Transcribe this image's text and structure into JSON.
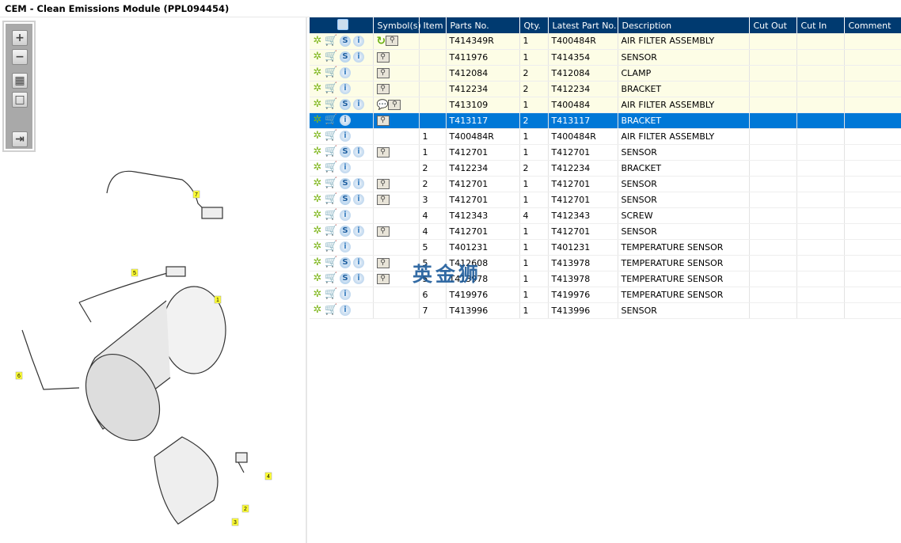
{
  "window": {
    "title": "CEM - Clean Emissions Module (PPL094454)"
  },
  "toolbar": {
    "buttons": [
      {
        "name": "zoom-in",
        "glyph": "+"
      },
      {
        "name": "zoom-out",
        "glyph": "−"
      },
      {
        "name": "fit-all",
        "glyph": "▦"
      },
      {
        "name": "fit-window",
        "glyph": "□"
      },
      {
        "name": "toggle-list",
        "glyph": "⇥"
      }
    ]
  },
  "diagram": {
    "callouts": [
      "1",
      "2",
      "3",
      "4",
      "5",
      "6",
      "7"
    ]
  },
  "table": {
    "headers": [
      "",
      "Symbol(s)",
      "Item",
      "Parts No.",
      "Qty.",
      "Latest Part No.",
      "Description",
      "Cut Out",
      "Cut In",
      "Comment"
    ],
    "rows": [
      {
        "s": true,
        "sym": [
          "rotate",
          "book"
        ],
        "item": "",
        "part": "T414349R",
        "qty": "1",
        "latest": "T400484R",
        "desc": "AIR FILTER ASSEMBLY",
        "hl": "y"
      },
      {
        "s": true,
        "sym": [
          "book"
        ],
        "item": "",
        "part": "T411976",
        "qty": "1",
        "latest": "T414354",
        "desc": "SENSOR",
        "hl": "y"
      },
      {
        "s": false,
        "sym": [
          "book"
        ],
        "item": "",
        "part": "T412084",
        "qty": "2",
        "latest": "T412084",
        "desc": "CLAMP",
        "hl": "y"
      },
      {
        "s": false,
        "sym": [
          "book"
        ],
        "item": "",
        "part": "T412234",
        "qty": "2",
        "latest": "T412234",
        "desc": "BRACKET",
        "hl": "y"
      },
      {
        "s": true,
        "sym": [
          "note",
          "book"
        ],
        "item": "",
        "part": "T413109",
        "qty": "1",
        "latest": "T400484",
        "desc": "AIR FILTER ASSEMBLY",
        "hl": "y"
      },
      {
        "s": false,
        "sym": [
          "book"
        ],
        "item": "",
        "part": "T413117",
        "qty": "2",
        "latest": "T413117",
        "desc": "BRACKET",
        "hl": "sel"
      },
      {
        "s": false,
        "sym": [],
        "item": "1",
        "part": "T400484R",
        "qty": "1",
        "latest": "T400484R",
        "desc": "AIR FILTER ASSEMBLY",
        "hl": ""
      },
      {
        "s": true,
        "sym": [
          "book"
        ],
        "item": "1",
        "part": "T412701",
        "qty": "1",
        "latest": "T412701",
        "desc": "SENSOR",
        "hl": ""
      },
      {
        "s": false,
        "sym": [],
        "item": "2",
        "part": "T412234",
        "qty": "2",
        "latest": "T412234",
        "desc": "BRACKET",
        "hl": ""
      },
      {
        "s": true,
        "sym": [
          "book"
        ],
        "item": "2",
        "part": "T412701",
        "qty": "1",
        "latest": "T412701",
        "desc": "SENSOR",
        "hl": ""
      },
      {
        "s": true,
        "sym": [
          "book"
        ],
        "item": "3",
        "part": "T412701",
        "qty": "1",
        "latest": "T412701",
        "desc": "SENSOR",
        "hl": ""
      },
      {
        "s": false,
        "sym": [],
        "item": "4",
        "part": "T412343",
        "qty": "4",
        "latest": "T412343",
        "desc": "SCREW",
        "hl": ""
      },
      {
        "s": true,
        "sym": [
          "book"
        ],
        "item": "4",
        "part": "T412701",
        "qty": "1",
        "latest": "T412701",
        "desc": "SENSOR",
        "hl": ""
      },
      {
        "s": false,
        "sym": [],
        "item": "5",
        "part": "T401231",
        "qty": "1",
        "latest": "T401231",
        "desc": "TEMPERATURE SENSOR",
        "hl": ""
      },
      {
        "s": true,
        "sym": [
          "book"
        ],
        "item": "5",
        "part": "T412608",
        "qty": "1",
        "latest": "T413978",
        "desc": "TEMPERATURE SENSOR",
        "hl": ""
      },
      {
        "s": true,
        "sym": [
          "book"
        ],
        "item": "5",
        "part": "T413978",
        "qty": "1",
        "latest": "T413978",
        "desc": "TEMPERATURE SENSOR",
        "hl": ""
      },
      {
        "s": false,
        "sym": [],
        "item": "6",
        "part": "T419976",
        "qty": "1",
        "latest": "T419976",
        "desc": "TEMPERATURE SENSOR",
        "hl": ""
      },
      {
        "s": false,
        "sym": [],
        "item": "7",
        "part": "T413996",
        "qty": "1",
        "latest": "T413996",
        "desc": "SENSOR",
        "hl": ""
      }
    ]
  },
  "watermark": "英金狮",
  "colors": {
    "header": "#003a70",
    "selected": "#0078d7",
    "highlight": "#fdfde6"
  }
}
